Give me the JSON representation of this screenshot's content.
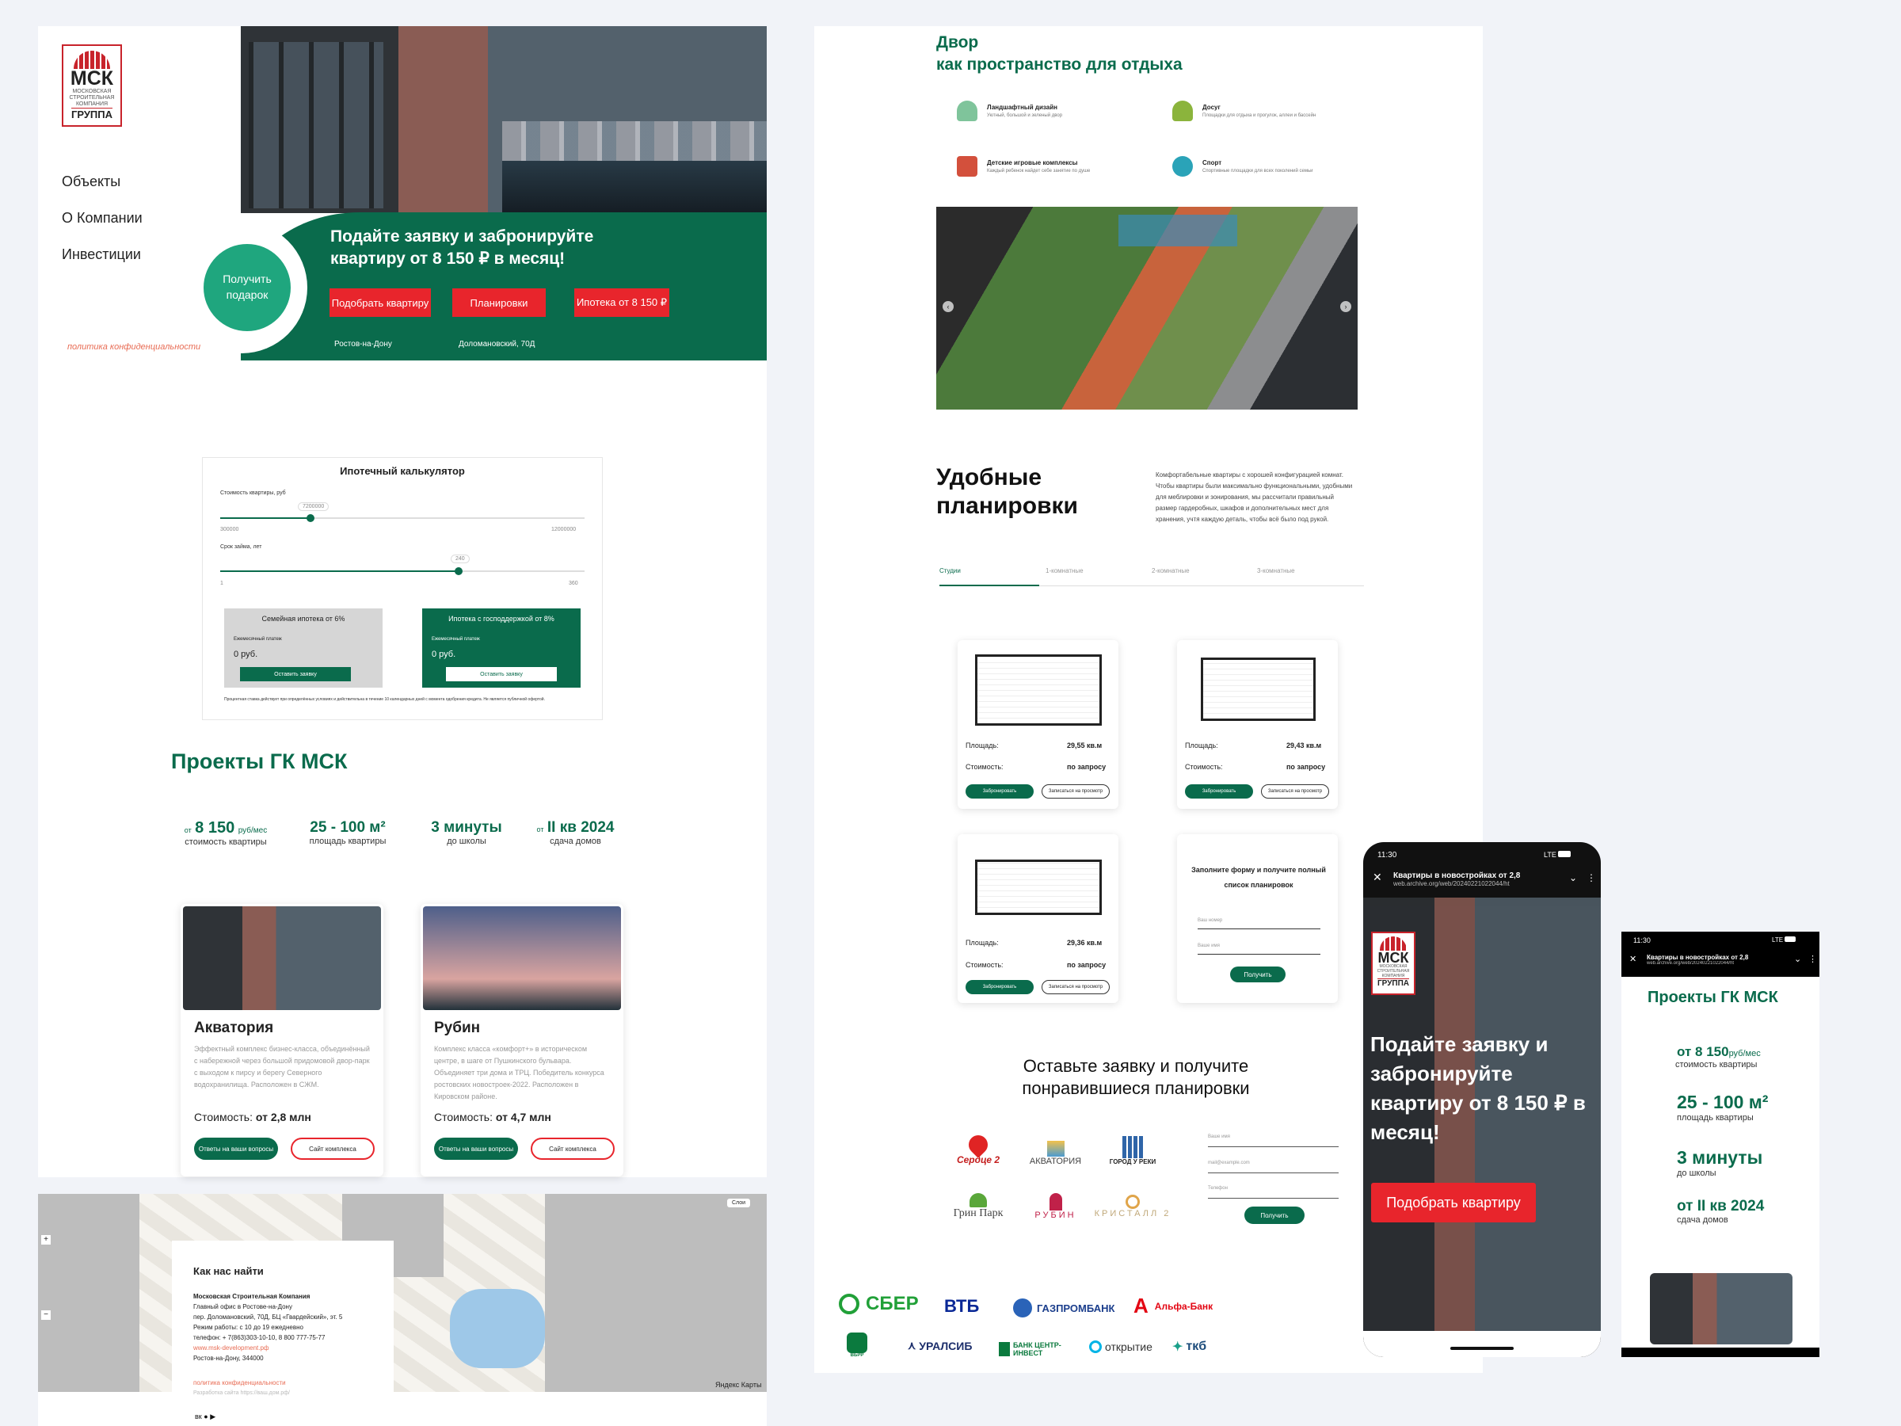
{
  "desktop1": {
    "logo": {
      "name": "МСК",
      "sub": "МОСКОВСКАЯ СТРОИТЕЛЬНАЯ КОМПАНИЯ",
      "group": "ГРУППА"
    },
    "nav": [
      "Объекты",
      "О Компании",
      "Инвестиции"
    ],
    "gift_button": "Получить подарок",
    "privacy": "политика конфиденциальности",
    "hero": {
      "title": "Подайте заявку и забронируйте квартиру от 8 150 ₽ в месяц!",
      "buttons": [
        "Подобрать квартиру",
        "Планировки",
        "Ипотека от 8 150 ₽"
      ],
      "city": "Ростов-на-Дону",
      "address": "Доломановский, 70Д"
    },
    "calc": {
      "title": "Ипотечный калькулятор",
      "cost_label": "Стоимость квартиры, руб",
      "cost_value": "7200000",
      "cost_min": "300000",
      "cost_max": "12000000",
      "term_label": "Срок займа, лет",
      "term_value": "240",
      "term_min": "1",
      "term_max": "360",
      "box1": {
        "title": "Семейная ипотека от 6%",
        "label": "Ежемесячный платеж",
        "value": "0 руб.",
        "btn": "Оставить заявку"
      },
      "box2": {
        "title": "Ипотека с господдержкой от 8%",
        "label": "Ежемесячный платеж",
        "value": "0 руб.",
        "btn": "Оставить заявку"
      },
      "note": "Процентная ставка действует при определённых условиях и действительна в течение 10 календарных дней с момента одобрения кредита. Не является публичной офертой."
    },
    "projects": {
      "title": "Проекты ГК МСК",
      "stats": [
        {
          "pre": "от",
          "big": "8 150",
          "unit": "руб/мес",
          "label": "стоимость квартиры"
        },
        {
          "pre": "",
          "big": "25 - 100 м²",
          "unit": "",
          "label": "площадь квартиры"
        },
        {
          "pre": "",
          "big": "3 минуты",
          "unit": "",
          "label": "до школы"
        },
        {
          "pre": "от",
          "big": "II кв 2024",
          "unit": "",
          "label": "сдача домов"
        }
      ],
      "cards": [
        {
          "name": "Акватория",
          "desc": "Эффектный комплекс бизнес-класса, объединённый с набережной через большой придомовой двор-парк с выходом к пирсу и берегу Северного водохранилища. Расположен в СЖМ.",
          "price_label": "Стоимость:",
          "price": "от 2,8 млн",
          "btn1": "Ответы на ваши вопросы",
          "btn2": "Сайт комплекса"
        },
        {
          "name": "Рубин",
          "desc": "Комплекс класса «комфорт+» в историческом центре, в шаге от Пушкинского бульвара. Объединяет три дома и ТРЦ. Победитель конкурса ростовских новостроек-2022. Расположен в Кировском районе.",
          "price_label": "Стоимость:",
          "price": "от 4,7 млн",
          "btn1": "Ответы на ваши вопросы",
          "btn2": "Сайт комплекса"
        }
      ]
    },
    "map": {
      "title": "Как нас найти",
      "lines": [
        "Московская Строительная Компания",
        "Главный офис в Ростове-на-Дону",
        "пер. Доломановский, 70Д, БЦ «Гвардейский», эт. 5",
        "Режим работы: с 10 до 19 ежедневно",
        "телефон: + 7(863)303-10-10, 8 800 777-75-77",
        "www.msk-development.рф",
        "Ростов-на-Дону, 344000"
      ],
      "privacy": "политика конфиденциальности",
      "dev": "Разработка сайта https://ваш.дом.рф/",
      "map_brand": "Яндекс Карты",
      "layers": "Слои",
      "zoom_in": "+",
      "zoom_out": "−"
    }
  },
  "desktop2": {
    "yard": {
      "title1": "Двор",
      "title2": "как пространство для отдыха",
      "features": [
        {
          "t": "Ландшафтный дизайн",
          "d": "Уютный, большой и зеленый двор"
        },
        {
          "t": "Досуг",
          "d": "Площадки для отдыха и прогулок, аллеи и бассейн"
        },
        {
          "t": "Детские игровые комплексы",
          "d": "Каждый ребенок найдет себе занятие по душе"
        },
        {
          "t": "Спорт",
          "d": "Спортивные площадки для всех поколений семьи"
        }
      ]
    },
    "plans": {
      "title": "Удобные планировки",
      "desc": "Комфортабельные квартиры с хорошей конфигурацией комнат. Чтобы квартиры были максимально функциональными, удобными для меблировки и зонирования, мы рассчитали правильный размер гардеробных, шкафов и дополнительных мест для хранения, учтя каждую деталь, чтобы всё было под рукой.",
      "tabs": [
        "Студии",
        "1-комнатные",
        "2-комнатные",
        "3-комнатные"
      ],
      "items": [
        {
          "area_label": "Площадь:",
          "area": "29,55 кв.м",
          "cost_label": "Стоимость:",
          "cost": "по запросу"
        },
        {
          "area_label": "Площадь:",
          "area": "29,43 кв.м",
          "cost_label": "Стоимость:",
          "cost": "по запросу"
        },
        {
          "area_label": "Площадь:",
          "area": "29,36 кв.м",
          "cost_label": "Стоимость:",
          "cost": "по запросу"
        }
      ],
      "btn_book": "Забронировать",
      "btn_view": "Записаться на просмотр",
      "form": {
        "title": "Заполните форму и получите полный список планировок",
        "f1": "Ваш номер",
        "f2": "Ваше имя",
        "btn": "Получить"
      }
    },
    "request": {
      "title": "Оставьте заявку и получите понравившиеся планировки",
      "f1": "Ваше имя",
      "f2": "mail@example.com",
      "f3": "Телефон",
      "btn": "Получить"
    },
    "logos": [
      "Сердце 2",
      "АКВАТОРИЯ",
      "ГОРОД У РЕКИ",
      "Грин Парк",
      "РУБИН",
      "КРИСТАЛЛ 2"
    ],
    "banks": [
      "СБЕР",
      "ВТБ",
      "ГАЗПРОМБАНК",
      "Альфа-Банк",
      "ВБРР",
      "УРАЛСИБ",
      "БАНК ЦЕНТР-ИНВЕСТ",
      "открытие",
      "ткб"
    ]
  },
  "mobile1": {
    "time": "11:30",
    "net": "LTE",
    "tab_title": "Квартиры в новостройках от 2,8",
    "tab_url": "web.archive.org/web/20240221022044/ht",
    "hero": "Подайте заявку и забронируйте квартиру от 8 150 ₽ в месяц!",
    "btn": "Подобрать квартиру"
  },
  "mobile2": {
    "time": "11:30",
    "net": "LTE",
    "tab_title": "Квартиры в новостройках от 2,8",
    "tab_url": "web.archive.org/web/20240221022044/ht",
    "title": "Проекты ГК МСК",
    "stats": [
      {
        "big": "от 8 150",
        "unit": "руб/мес",
        "label": "стоимость квартиры"
      },
      {
        "big": "25 - 100 м²",
        "unit": "",
        "label": "площадь квартиры"
      },
      {
        "big": "3 минуты",
        "unit": "",
        "label": "до школы"
      },
      {
        "big": "от II кв 2024",
        "unit": "",
        "label": "сдача домов"
      }
    ]
  },
  "colors": {
    "green": "#0a6b4c",
    "red": "#e8252c",
    "bg": "#f1f3f8"
  }
}
